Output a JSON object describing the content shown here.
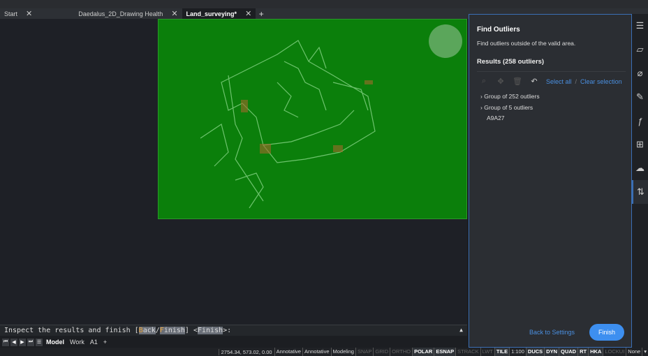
{
  "tabs": [
    {
      "label": "Start"
    },
    {
      "label": "Daedalus_2D_Drawing Health"
    },
    {
      "label": "Land_surveying*"
    }
  ],
  "colors": {
    "viewport": "#0b7f0b",
    "accent": "#3d8ff0",
    "link": "#4a8fe0"
  },
  "panel": {
    "title": "Find Outliers",
    "description": "Find outliers outside of the valid area.",
    "results": "Results (258 outliers)",
    "select_all": "Select all",
    "slash": "/",
    "clear_selection": "Clear selection",
    "items": [
      {
        "label": "Group of 252 outliers",
        "expandable": true
      },
      {
        "label": "Group of 5 outliers",
        "expandable": true
      },
      {
        "label": "A9A27",
        "expandable": false
      }
    ],
    "back": "Back to Settings",
    "finish": "Finish"
  },
  "command": {
    "pre": "Inspect the results and finish [",
    "b_key": "B",
    "b_rest": "ack",
    "sep": "/",
    "f_key": "F",
    "f_rest": "inish",
    "mid": "] <",
    "default": "Finish",
    "post": ">:"
  },
  "layout_tabs": [
    "Model",
    "Work",
    "A1",
    "+"
  ],
  "status": {
    "coords": "2754.34, 573.02, 0.00",
    "items": [
      {
        "l": "Annotative",
        "s": "n"
      },
      {
        "l": "Annotative",
        "s": "n"
      },
      {
        "l": "Modeling",
        "s": "n"
      },
      {
        "l": "SNAP",
        "s": "off"
      },
      {
        "l": "GRID",
        "s": "off"
      },
      {
        "l": "ORTHO",
        "s": "off"
      },
      {
        "l": "POLAR",
        "s": "on"
      },
      {
        "l": "ESNAP",
        "s": "on"
      },
      {
        "l": "STRACK",
        "s": "off"
      },
      {
        "l": "LWT",
        "s": "off"
      },
      {
        "l": "TILE",
        "s": "on"
      },
      {
        "l": "1:100",
        "s": "n"
      },
      {
        "l": "DUCS",
        "s": "on"
      },
      {
        "l": "DYN",
        "s": "on"
      },
      {
        "l": "QUAD",
        "s": "on"
      },
      {
        "l": "RT",
        "s": "on"
      },
      {
        "l": "HKA",
        "s": "on"
      },
      {
        "l": "LOCKUI",
        "s": "off"
      },
      {
        "l": "None",
        "s": "n"
      }
    ]
  }
}
